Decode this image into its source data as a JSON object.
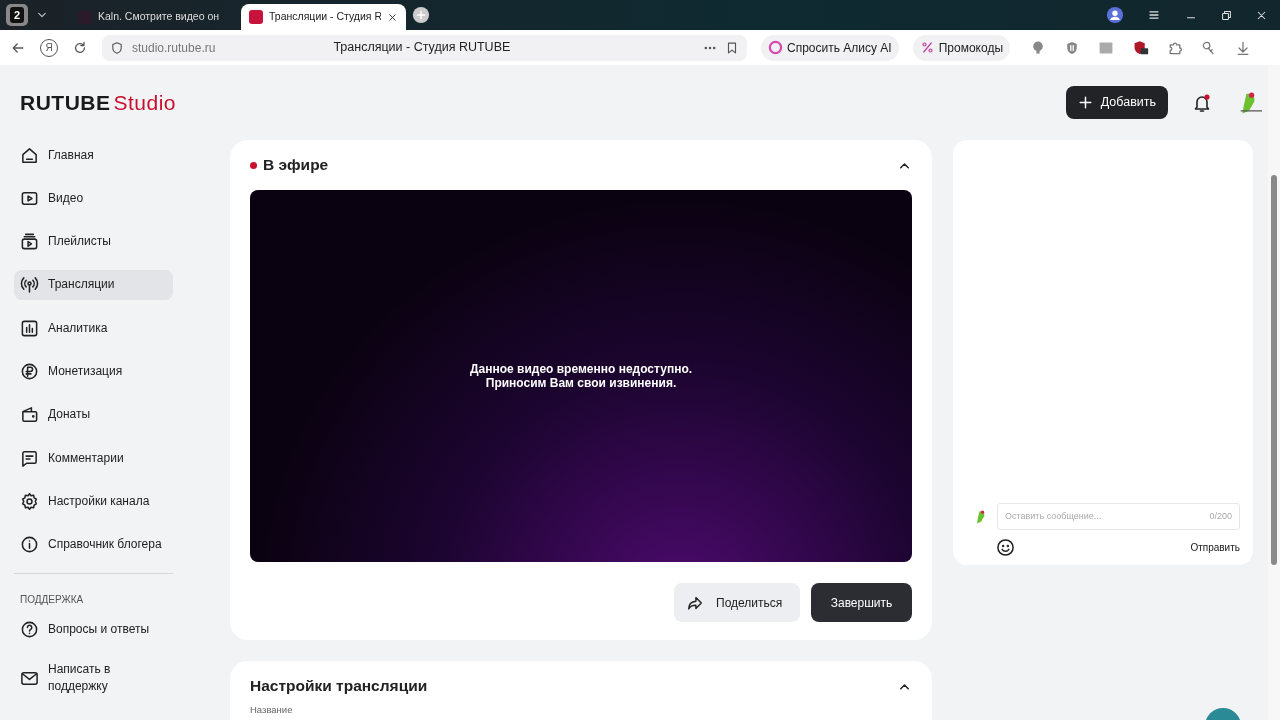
{
  "browser": {
    "tab_count": "2",
    "home_glyph": "Я",
    "address": "studio.rutube.ru",
    "page_title": "Трансляции - Студия RUTUBE",
    "tabs": [
      {
        "title": "Kaln. Смотрите видео он",
        "selected": false
      },
      {
        "title": "Трансляции - Студия R",
        "selected": true
      }
    ],
    "pills": [
      {
        "label": "Спросить Алису AI"
      },
      {
        "label": "Промокоды"
      }
    ]
  },
  "header": {
    "logo": {
      "brand": "RUTUBE",
      "suffix": "Studio"
    },
    "add_button": "Добавить",
    "notifications_unread": true
  },
  "sidebar": {
    "items": [
      {
        "label": "Главная",
        "selected": false
      },
      {
        "label": "Видео",
        "selected": false
      },
      {
        "label": "Плейлисты",
        "selected": false
      },
      {
        "label": "Трансляции",
        "selected": true
      },
      {
        "label": "Аналитика",
        "selected": false
      },
      {
        "label": "Монетизация",
        "selected": false
      },
      {
        "label": "Донаты",
        "selected": false
      },
      {
        "label": "Комментарии",
        "selected": false
      },
      {
        "label": "Настройки канала",
        "selected": false
      },
      {
        "label": "Справочник блогера",
        "selected": false
      }
    ],
    "support_heading": "ПОДДЕРЖКА",
    "support_items": [
      {
        "label": "Вопросы и ответы",
        "selected": false
      },
      {
        "label": "Написать в поддержку",
        "selected": false
      }
    ]
  },
  "live_panel": {
    "status": "В эфире",
    "live": true,
    "expanded": true,
    "message": [
      "Данное видео временно недоступно.",
      "Приносим Вам свои извинения."
    ],
    "share_button": "Поделиться",
    "finish_button": "Завершить"
  },
  "chat": {
    "placeholder": "Оставить сообщение...",
    "counter": "0/200",
    "send": "Отправить"
  },
  "settings_panel": {
    "title": "Настройки трансляции",
    "expanded": true,
    "field_label": "Название"
  }
}
